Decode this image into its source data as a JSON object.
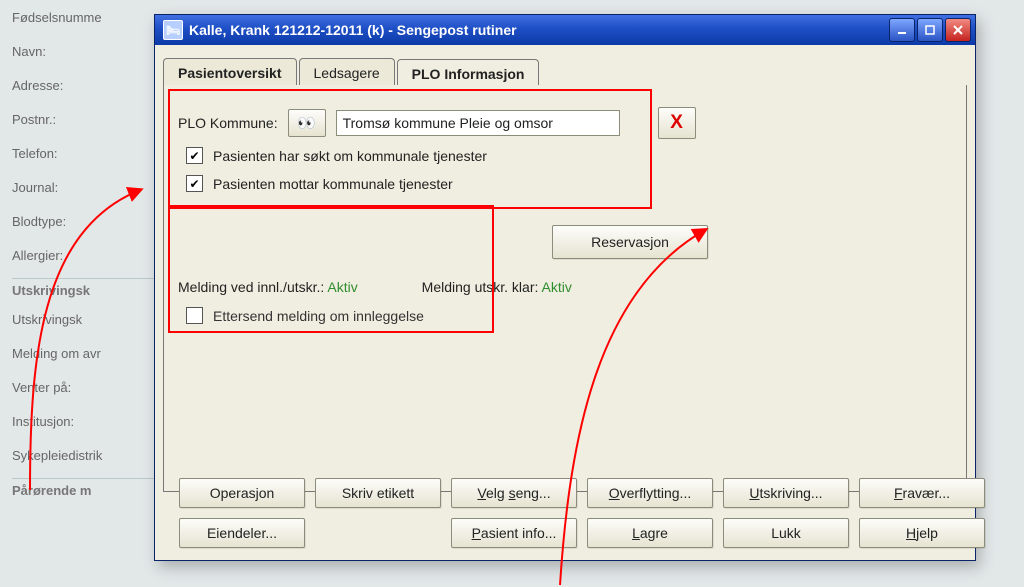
{
  "dialog": {
    "title": "Kalle, Krank  121212-12011 (k) - Sengepost rutiner"
  },
  "tabs": {
    "t0": "Pasientoversikt",
    "t1": "Ledsagere",
    "t2": "PLO Informasjon"
  },
  "plo": {
    "label": "PLO Kommune:",
    "value": "Tromsø kommune Pleie og omsor",
    "chk1": "Pasienten har søkt om kommunale tjenester",
    "chk2": "Pasienten mottar kommunale tjenester",
    "reservasjon": "Reservasjon",
    "status_a_label": "Melding ved innl./utskr.:",
    "status_a_value": "Aktiv",
    "status_b_label": "Melding utskr. klar:",
    "status_b_value": "Aktiv",
    "ettersend": "Ettersend melding om innleggelse"
  },
  "buttons": {
    "operasjon": "Operasjon",
    "skriv": "Skriv etikett",
    "velg_seng": "Velg seng...",
    "overflytting": "Overflytting...",
    "utskriving": "Utskriving...",
    "fravaer": "Fravær...",
    "eiendeler": "Eiendeler...",
    "pasient_info": "Pasient info...",
    "lagre": "Lagre",
    "lukk": "Lukk",
    "hjelp": "Hjelp"
  },
  "bg": {
    "fodselsnummer": "Fødselsnumme",
    "navn": "Navn:",
    "adresse": "Adresse:",
    "postnr": "Postnr.:",
    "telefon": "Telefon:",
    "journal": "Journal:",
    "blodtype": "Blodtype:",
    "allergier": "Allergier:",
    "utskrivingsk": "Utskrivingsk",
    "utskrivingsk2": "Utskrivingsk",
    "melding_om_avr": "Melding om avr",
    "venter_pa": "Venter på:",
    "institusjon": "Institusjon:",
    "sykepleiedistrik": "Sykepleiedistrik",
    "parorende": "Pårørende m"
  }
}
